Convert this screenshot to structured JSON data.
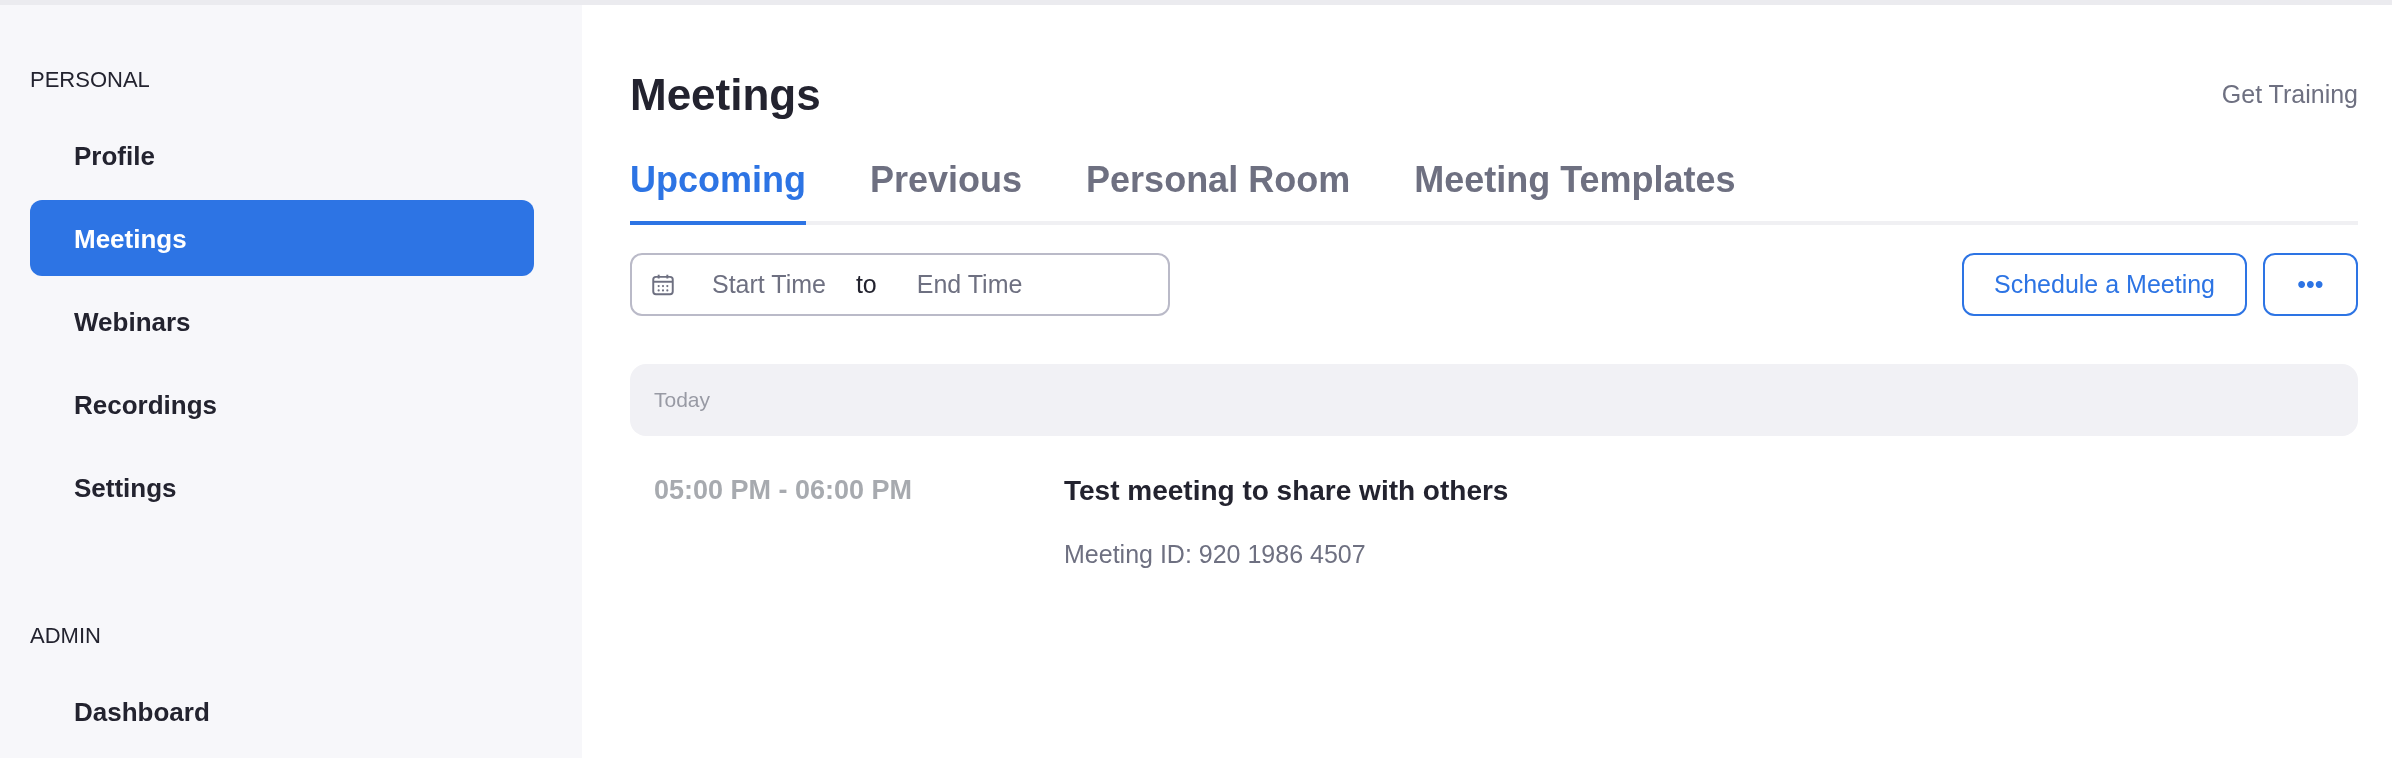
{
  "sidebar": {
    "sections": [
      {
        "label": "PERSONAL",
        "items": [
          {
            "label": "Profile",
            "selected": false
          },
          {
            "label": "Meetings",
            "selected": true
          },
          {
            "label": "Webinars",
            "selected": false
          },
          {
            "label": "Recordings",
            "selected": false
          },
          {
            "label": "Settings",
            "selected": false
          }
        ]
      },
      {
        "label": "ADMIN",
        "items": [
          {
            "label": "Dashboard",
            "selected": false
          }
        ]
      }
    ]
  },
  "page": {
    "title": "Meetings",
    "help_link": "Get Training"
  },
  "tabs": [
    {
      "label": "Upcoming",
      "selected": true
    },
    {
      "label": "Previous",
      "selected": false
    },
    {
      "label": "Personal Room",
      "selected": false
    },
    {
      "label": "Meeting Templates",
      "selected": false
    }
  ],
  "date_range": {
    "start_placeholder": "Start Time",
    "separator": "to",
    "end_placeholder": "End Time"
  },
  "buttons": {
    "schedule": "Schedule a Meeting",
    "more": "•••"
  },
  "groups": [
    {
      "label": "Today",
      "meetings": [
        {
          "time": "05:00 PM - 06:00 PM",
          "title": "Test meeting to share with others",
          "meeting_id": "Meeting ID: 920 1986 4507"
        }
      ]
    }
  ]
}
